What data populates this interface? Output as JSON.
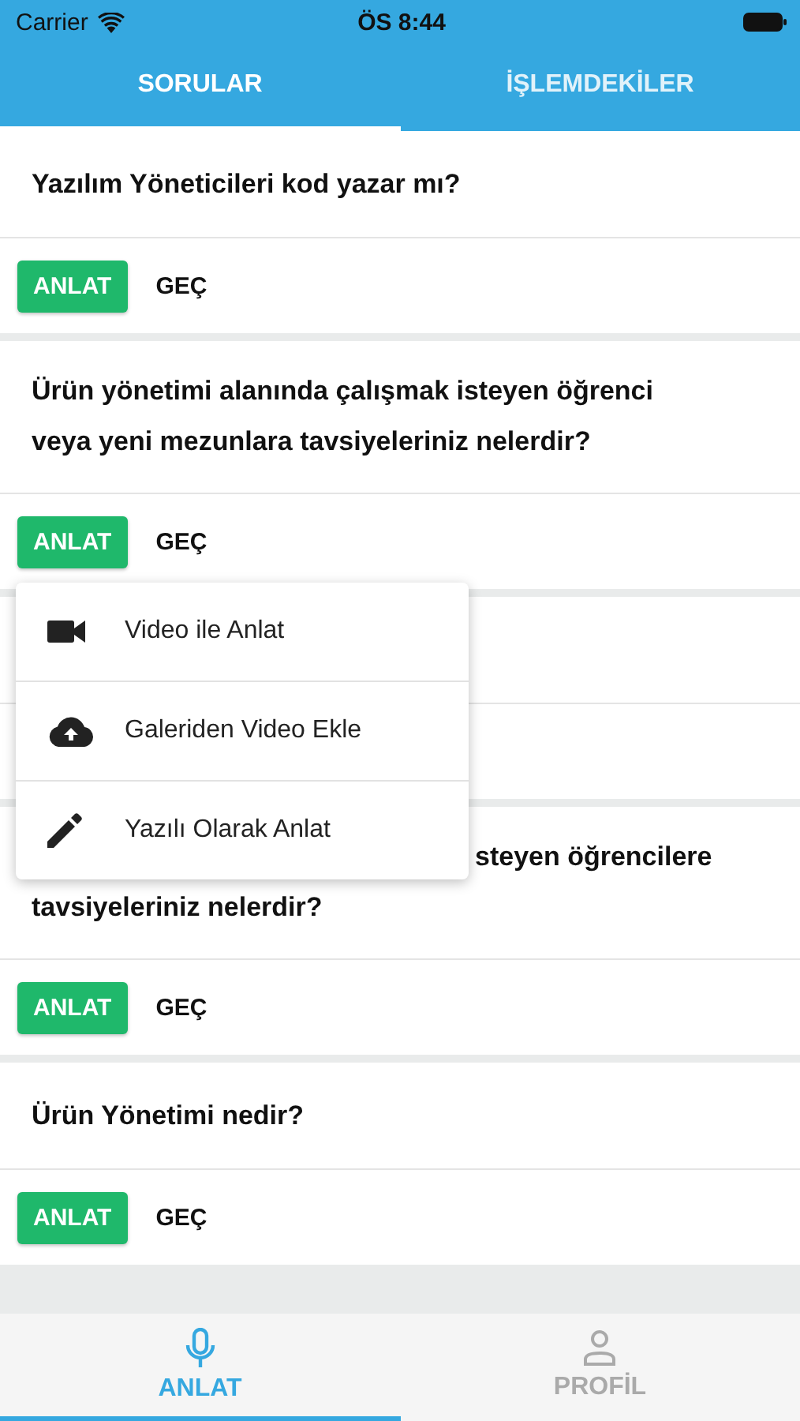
{
  "status_bar": {
    "carrier": "Carrier",
    "time": "ÖS 8:44"
  },
  "tabs": [
    {
      "label": "SORULAR",
      "selected": true
    },
    {
      "label": "İŞLEMDEKİLER",
      "selected": false
    }
  ],
  "cards": [
    {
      "kind": "full",
      "lines": [
        "Yazılım Yöneticileri kod yazar mı?"
      ],
      "actions": [
        "ANLAT",
        "GEÇ"
      ]
    },
    {
      "kind": "full",
      "lines": [
        "Ürün yönetimi alanında çalışmak isteyen öğrenci",
        "veya yeni mezunlara tavsiyeleriniz nelerdir?"
      ],
      "actions": [
        "ANLAT",
        "GEÇ"
      ]
    },
    {
      "kind": "covered"
    },
    {
      "kind": "partial",
      "lines": [
        "steyen öğrencilere",
        "tavsiyeleriniz nelerdir?"
      ],
      "actions": [
        "ANLAT",
        "GEÇ"
      ]
    },
    {
      "kind": "full",
      "lines": [
        "Ürün Yönetimi nedir?"
      ],
      "actions": [
        "ANLAT",
        "GEÇ"
      ]
    }
  ],
  "menu": [
    {
      "label": "Video ile Anlat"
    },
    {
      "label": "Galeriden Video Ekle"
    },
    {
      "label": "Yazılı Olarak Anlat"
    }
  ],
  "bottom_tabs": [
    {
      "label": "ANLAT",
      "selected": true
    },
    {
      "label": "PROFİL",
      "selected": false
    }
  ]
}
